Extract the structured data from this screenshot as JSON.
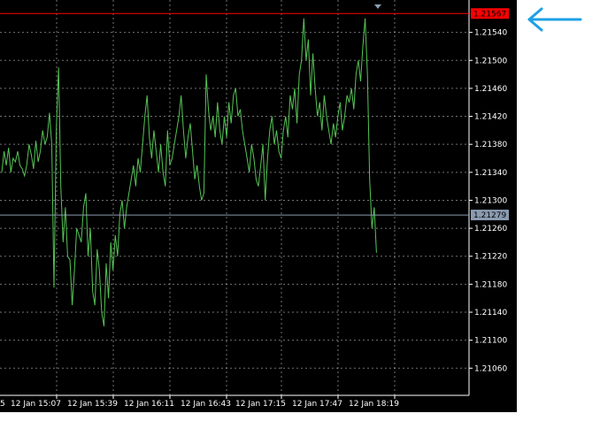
{
  "colors": {
    "background": "#000000",
    "grid": "#c0c0c0",
    "axis_text": "#ffffff",
    "price_line": "#55c455",
    "ask_line": "#ff0000",
    "bid_line": "#8a9bb0",
    "ask_label_bg": "#ff0000",
    "ask_label_text": "#000000",
    "bid_label_bg": "#8a9bb0",
    "bid_label_text": "#000000",
    "arrow": "#1ea0e6"
  },
  "icons": {
    "pointer": "arrow-left-icon",
    "shift_marker": "triangle-down-icon"
  },
  "price_labels": {
    "ask": "1.21567",
    "bid": "1.21279"
  },
  "chart_data": {
    "type": "line",
    "y_ticks": [
      "1.21540",
      "1.21500",
      "1.21460",
      "1.21420",
      "1.21380",
      "1.21340",
      "1.21300",
      "1.21260",
      "1.21220",
      "1.21180",
      "1.21140",
      "1.21100",
      "1.21060"
    ],
    "x_ticks": [
      "5",
      "12 Jan 15:07",
      "12 Jan 15:39",
      "12 Jan 16:11",
      "12 Jan 16:43",
      "12 Jan 17:15",
      "12 Jan 17:47",
      "12 Jan 18:19"
    ],
    "ylim": [
      1.2103,
      1.2158
    ],
    "xlim": [
      0,
      166
    ],
    "ask": 1.21567,
    "bid": 1.21279,
    "grid": true,
    "series": [
      {
        "values": [
          1.2134,
          1.2137,
          1.2135,
          1.21375,
          1.2134,
          1.2136,
          1.21355,
          1.2137,
          1.2135,
          1.21345,
          1.21335,
          1.2135,
          1.2138,
          1.21365,
          1.21345,
          1.21385,
          1.21355,
          1.2137,
          1.214,
          1.2138,
          1.2139,
          1.21425,
          1.2138,
          1.21175,
          1.214,
          1.2149,
          1.2132,
          1.2124,
          1.2129,
          1.2122,
          1.21215,
          1.2115,
          1.212,
          1.2126,
          1.2125,
          1.2124,
          1.2129,
          1.2131,
          1.2122,
          1.2126,
          1.2117,
          1.2115,
          1.2123,
          1.212,
          1.2114,
          1.2112,
          1.2121,
          1.2116,
          1.2124,
          1.212,
          1.2125,
          1.2122,
          1.2128,
          1.213,
          1.2126,
          1.2129,
          1.2131,
          1.2133,
          1.2135,
          1.2132,
          1.2136,
          1.2134,
          1.2138,
          1.2142,
          1.2145,
          1.2139,
          1.2136,
          1.214,
          1.2137,
          1.2134,
          1.2138,
          1.2134,
          1.2132,
          1.214,
          1.2135,
          1.2136,
          1.2138,
          1.214,
          1.2142,
          1.2145,
          1.214,
          1.2136,
          1.2139,
          1.2141,
          1.2137,
          1.2133,
          1.2135,
          1.2132,
          1.213,
          1.2131,
          1.2148,
          1.2143,
          1.214,
          1.2142,
          1.2139,
          1.2144,
          1.214,
          1.2138,
          1.2142,
          1.2139,
          1.2144,
          1.2141,
          1.2145,
          1.2146,
          1.2142,
          1.2143,
          1.214,
          1.2138,
          1.2136,
          1.2134,
          1.2138,
          1.2136,
          1.2133,
          1.2132,
          1.2135,
          1.2138,
          1.213,
          1.2136,
          1.214,
          1.2142,
          1.2138,
          1.214,
          1.2137,
          1.2136,
          1.214,
          1.2142,
          1.2139,
          1.2145,
          1.2143,
          1.2146,
          1.2141,
          1.2148,
          1.215,
          1.2156,
          1.215,
          1.2153,
          1.2145,
          1.2151,
          1.2146,
          1.2142,
          1.2144,
          1.214,
          1.2145,
          1.2142,
          1.214,
          1.2138,
          1.2141,
          1.2139,
          1.2142,
          1.2144,
          1.214,
          1.2142,
          1.2145,
          1.2144,
          1.2146,
          1.2143,
          1.2148,
          1.215,
          1.2147,
          1.2152,
          1.2156,
          1.2148,
          1.2133,
          1.2126,
          1.2129,
          1.21225
        ]
      }
    ]
  }
}
